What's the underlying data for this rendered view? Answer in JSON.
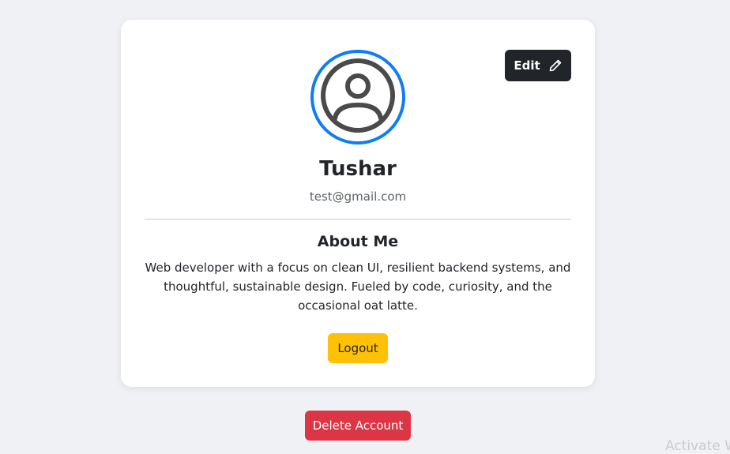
{
  "profile": {
    "name": "Tushar",
    "email": "test@gmail.com",
    "avatar_icon": "user-circle-icon",
    "avatar_ring_color": "#0d7ef4"
  },
  "actions": {
    "edit_label": "Edit",
    "edit_icon": "pencil-icon",
    "logout_label": "Logout",
    "delete_label": "Delete Account"
  },
  "about": {
    "title": "About Me",
    "text": "Web developer with a focus on clean UI, resilient backend systems, and thoughtful, sustainable design. Fueled by code, curiosity, and the occasional oat latte."
  },
  "system": {
    "watermark": "Activate W"
  },
  "colors": {
    "edit_button": "#212529",
    "logout_button": "#ffc107",
    "delete_button": "#dc3545"
  }
}
